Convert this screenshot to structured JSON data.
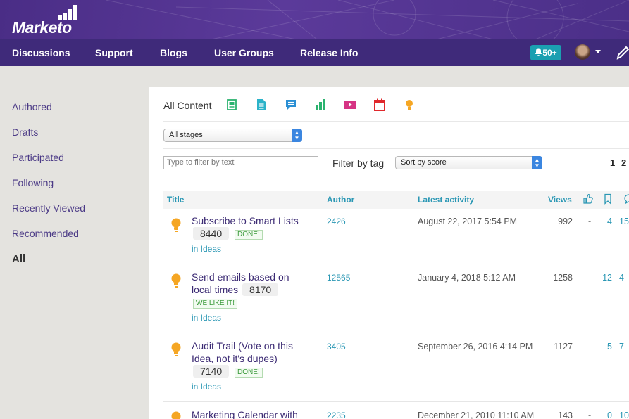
{
  "header": {
    "logo_text": "Marketo",
    "nav": [
      "Discussions",
      "Support",
      "Blogs",
      "User Groups",
      "Release Info"
    ],
    "notifications": "50+"
  },
  "sidebar": {
    "items": [
      "Authored",
      "Drafts",
      "Participated",
      "Following",
      "Recently Viewed",
      "Recommended",
      "All"
    ],
    "active": "All"
  },
  "filters": {
    "all_content_label": "All Content",
    "content_type_icons": [
      "document-icon",
      "file-icon",
      "discussion-icon",
      "poll-icon",
      "video-icon",
      "event-icon",
      "idea-icon"
    ],
    "stage_select": "All stages",
    "text_filter_placeholder": "Type to filter by text",
    "filter_by_tag": "Filter by tag",
    "sort_select": "Sort by score",
    "pages": [
      "1",
      "2"
    ]
  },
  "table": {
    "headers": {
      "title": "Title",
      "author": "Author",
      "latest": "Latest activity",
      "views": "Views"
    },
    "header_icons": [
      "like-icon",
      "bookmark-icon",
      "reply-icon"
    ],
    "rows": [
      {
        "title": "Subscribe to Smart Lists",
        "score": "8440",
        "status": "DONE!",
        "place": "in Ideas",
        "author": "2426",
        "latest": "August 22, 2017 5:54 PM",
        "views": "992",
        "likes": "-",
        "bookmarks": "4",
        "replies": "15"
      },
      {
        "title": "Send emails based on local times",
        "score": "8170",
        "status": "WE LIKE IT!",
        "place": "in Ideas",
        "author": "12565",
        "latest": "January 4, 2018 5:12 AM",
        "views": "1258",
        "likes": "-",
        "bookmarks": "12",
        "replies": "4"
      },
      {
        "title": "Audit Trail (Vote on this Idea, not it's dupes)",
        "score": "7140",
        "status": "DONE!",
        "place": "in Ideas",
        "author": "3405",
        "latest": "September 26, 2016 4:14 PM",
        "views": "1127",
        "likes": "-",
        "bookmarks": "5",
        "replies": "7"
      },
      {
        "title": "Marketing Calendar with",
        "score": "",
        "status": "",
        "place": "",
        "author": "2235",
        "latest": "December 21, 2010 11:10 AM",
        "views": "143",
        "likes": "-",
        "bookmarks": "0",
        "replies": "10"
      }
    ]
  },
  "colors": {
    "header_purple": "#4a2d86",
    "nav_purple": "#3f2a7a",
    "link_teal": "#2a97b4",
    "title_purple": "#3b2a73",
    "idea_orange": "#f5a623",
    "notif_teal": "#1b9fb1"
  }
}
